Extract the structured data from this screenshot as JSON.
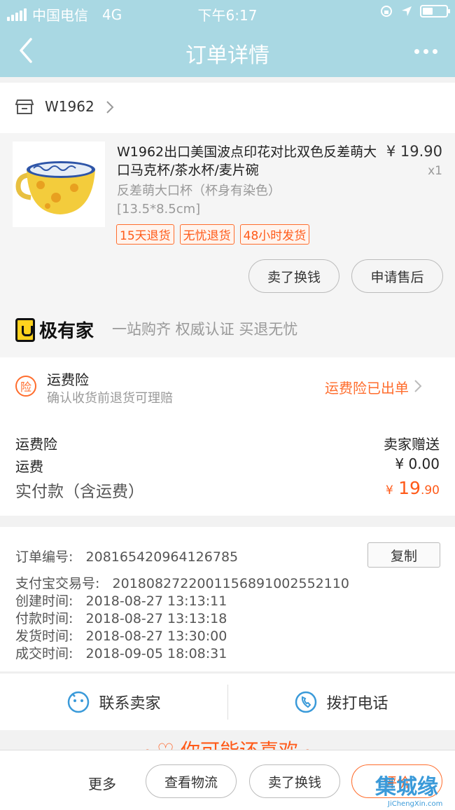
{
  "status_bar": {
    "carrier": "中国电信",
    "network": "4G",
    "time": "下午6:17"
  },
  "nav": {
    "title": "订单详情"
  },
  "shop": {
    "name": "W1962"
  },
  "product": {
    "title": "W1962出口美国波点印花对比双色反差萌大口马克杯/茶水杯/麦片碗",
    "price": "¥ 19.90",
    "quantity": "x1",
    "spec_line1": "反差萌大口杯（杯身有染色）",
    "spec_line2": "[13.5*8.5cm]",
    "tags": [
      "15天退货",
      "无忧退货",
      "48小时发货"
    ],
    "buttons": {
      "sell": "卖了换钱",
      "after_sale": "申请售后"
    },
    "brand": {
      "name": "极有家",
      "slogan": "一站购齐 权威认证 买退无忧"
    }
  },
  "insurance": {
    "icon_text": "险",
    "title": "运费险",
    "subtitle": "确认收货前退货可理赔",
    "status": "运费险已出单"
  },
  "fees": {
    "insurance_label": "运费险",
    "insurance_value": "卖家赠送",
    "shipping_label": "运费",
    "shipping_value": "¥ 0.00",
    "total_label": "实付款（含运费）",
    "total_currency": "¥",
    "total_int": "19",
    "total_dec": ".90"
  },
  "order": {
    "number_label": "订单编号:",
    "number": "208165420964126785",
    "copy_label": "复制",
    "alipay_label": "支付宝交易号:",
    "alipay": "2018082722001156891002552110",
    "created_label": "创建时间:",
    "created": "2018-08-27 13:13:11",
    "paid_label": "付款时间:",
    "paid": "2018-08-27 13:13:18",
    "shipped_label": "发货时间:",
    "shipped": "2018-08-27 13:30:00",
    "done_label": "成交时间:",
    "done": "2018-09-05 18:08:31"
  },
  "contact": {
    "seller": "联系卖家",
    "call": "拨打电话"
  },
  "recommend": {
    "title": "· ♡ 你可能还喜欢 ·"
  },
  "bottom": {
    "more": "更多",
    "logistics": "查看物流",
    "sell": "卖了换钱",
    "review": "评价"
  },
  "watermark": {
    "main": "集城缘",
    "sub": "JiChengXin.com"
  },
  "colors": {
    "nav": "#a9d8e3",
    "accent": "#ff5a19"
  }
}
